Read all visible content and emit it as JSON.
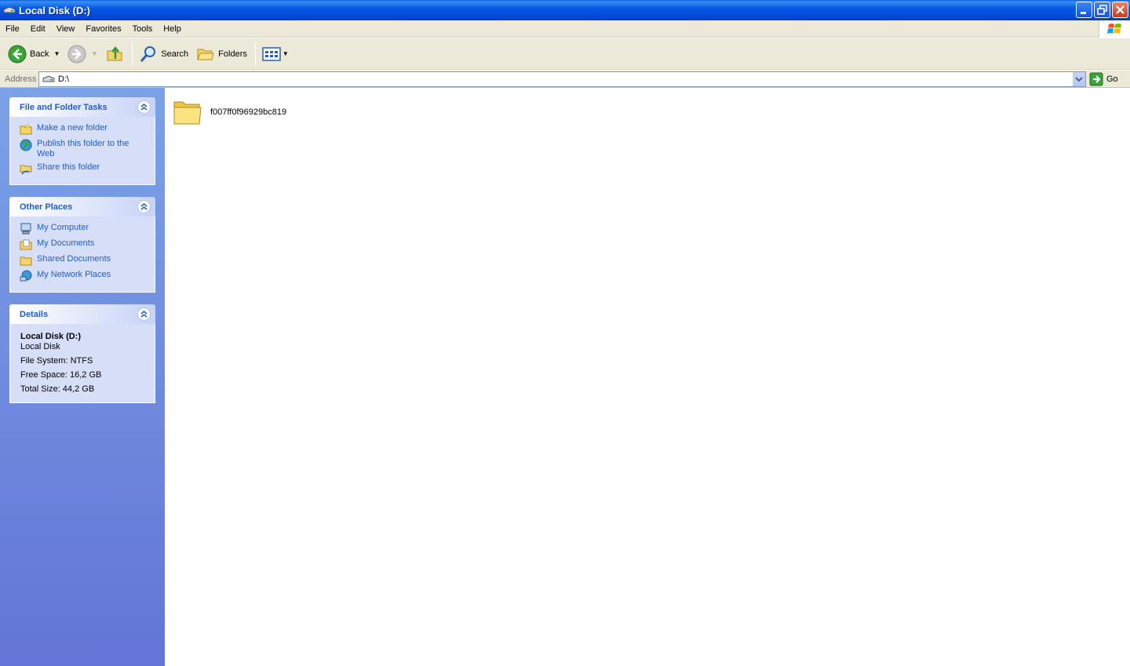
{
  "window": {
    "title": "Local Disk (D:)"
  },
  "menu": {
    "items": [
      "File",
      "Edit",
      "View",
      "Favorites",
      "Tools",
      "Help"
    ]
  },
  "toolbar": {
    "back": "Back",
    "search": "Search",
    "folders": "Folders"
  },
  "address": {
    "label": "Address",
    "value": "D:\\",
    "go": "Go"
  },
  "panels": {
    "tasks": {
      "title": "File and Folder Tasks",
      "items": [
        "Make a new folder",
        "Publish this folder to the Web",
        "Share this folder"
      ]
    },
    "places": {
      "title": "Other Places",
      "items": [
        "My Computer",
        "My Documents",
        "Shared Documents",
        "My Network Places"
      ]
    },
    "details": {
      "title": "Details",
      "name": "Local Disk (D:)",
      "type": "Local Disk",
      "fs": "File System: NTFS",
      "free": "Free Space: 16,2 GB",
      "total": "Total Size: 44,2 GB"
    }
  },
  "content": {
    "folders": [
      "f007ff0f96929bc819"
    ]
  }
}
